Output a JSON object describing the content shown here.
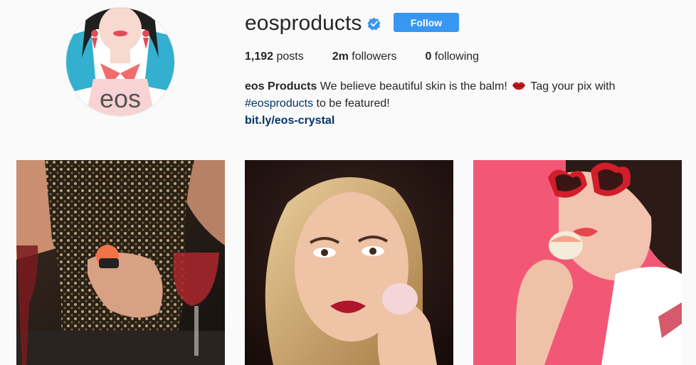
{
  "profile": {
    "username": "eosproducts",
    "avatar_logo_text": "eos",
    "verified_icon": "verified-badge-icon",
    "follow_label": "Follow",
    "accent_color": "#3897f0"
  },
  "stats": {
    "posts_count": "1,192",
    "posts_label": " posts",
    "followers_count": "2m",
    "followers_label": " followers",
    "following_count": "0",
    "following_label": " following"
  },
  "bio": {
    "full_name": "eos Products",
    "text_part1": " We believe beautiful skin is the balm! ",
    "emoji": "lips-emoji",
    "text_part2": " Tag your pix with ",
    "hashtag": "#eosproducts",
    "text_part3": " to be featured!",
    "link": "bit.ly/eos-crystal"
  },
  "posts": [
    {
      "name": "post-sequin-dress-lip-balm"
    },
    {
      "name": "post-blonde-model-lip-balm"
    },
    {
      "name": "post-red-heart-sunglasses-lip-balm"
    }
  ]
}
